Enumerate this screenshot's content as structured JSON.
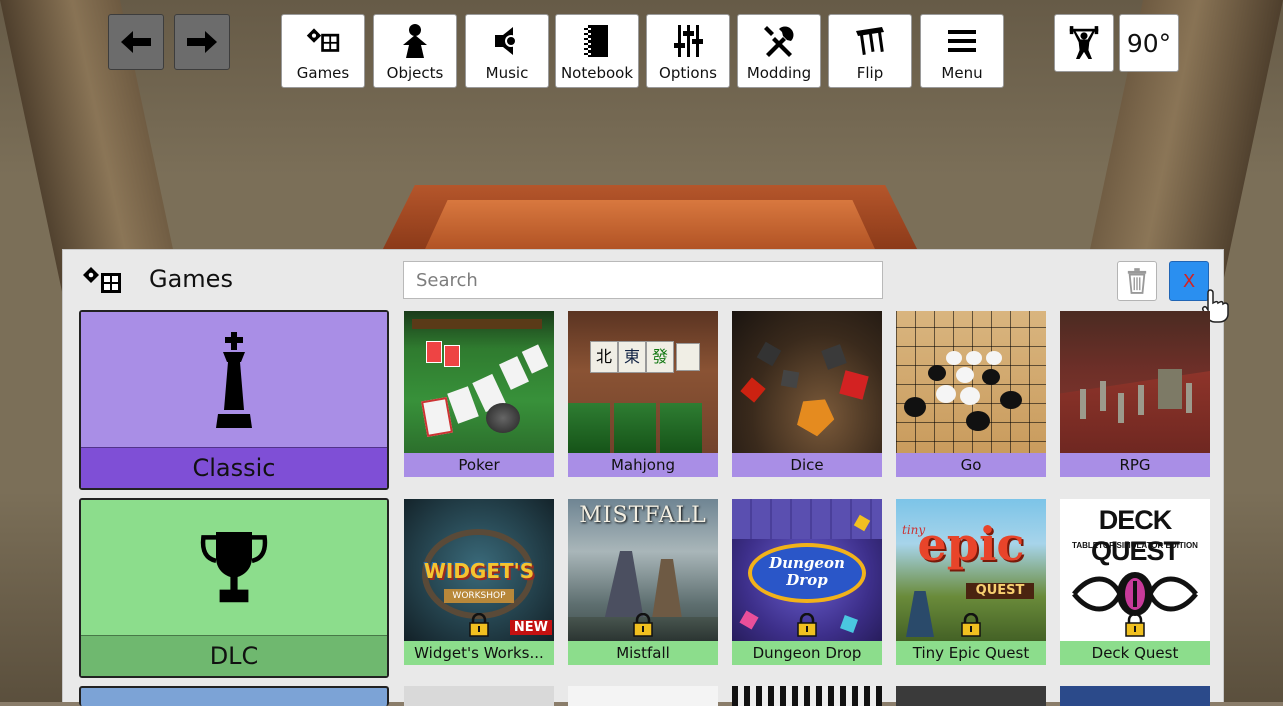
{
  "toolbar": {
    "back_icon": "arrow-left-icon",
    "forward_icon": "arrow-right-icon",
    "items": [
      {
        "label": "Games",
        "icon": "games-icon"
      },
      {
        "label": "Objects",
        "icon": "pawn-icon"
      },
      {
        "label": "Music",
        "icon": "speaker-icon"
      },
      {
        "label": "Notebook",
        "icon": "notebook-icon"
      },
      {
        "label": "Options",
        "icon": "sliders-icon"
      },
      {
        "label": "Modding",
        "icon": "tools-icon"
      },
      {
        "label": "Flip",
        "icon": "flip-table-icon"
      },
      {
        "label": "Menu",
        "icon": "hamburger-icon"
      }
    ],
    "physics_icon": "weightlifter-icon",
    "rotation": "90°"
  },
  "panel": {
    "title": "Games",
    "search_placeholder": "Search",
    "close_label": "X",
    "categories": [
      {
        "label": "Classic",
        "icon": "chess-king-icon",
        "color": "#a98ee6",
        "label_color": "#7f4fd6"
      },
      {
        "label": "DLC",
        "icon": "trophy-icon",
        "color": "#8cdd8c",
        "label_color": "#6fb86f"
      },
      {
        "label": "",
        "icon": "",
        "color": "#7ca3d6"
      }
    ],
    "games_row1": [
      "Poker",
      "Mahjong",
      "Dice",
      "Go",
      "RPG"
    ],
    "games_row2": [
      {
        "label": "Widget's Works...",
        "badge": "NEW"
      },
      {
        "label": "Mistfall"
      },
      {
        "label": "Dungeon Drop"
      },
      {
        "label": "Tiny Epic Quest"
      },
      {
        "label": "Deck Quest"
      }
    ],
    "art_text": {
      "mahjong_tiles": [
        "北",
        "東",
        "發"
      ],
      "widget_logo": "WIDGET'S",
      "widget_sub": "WORKSHOP",
      "mistfall_logo": "MISTFALL",
      "dungeon_logo": "Dungeon Drop",
      "tiny_logo": "epic",
      "tiny_small": "tiny",
      "tiny_sub": "QUEST",
      "deck_title": "DECK QUEST",
      "deck_sub": "TABLETOP SIMULATOR EDITION"
    }
  }
}
